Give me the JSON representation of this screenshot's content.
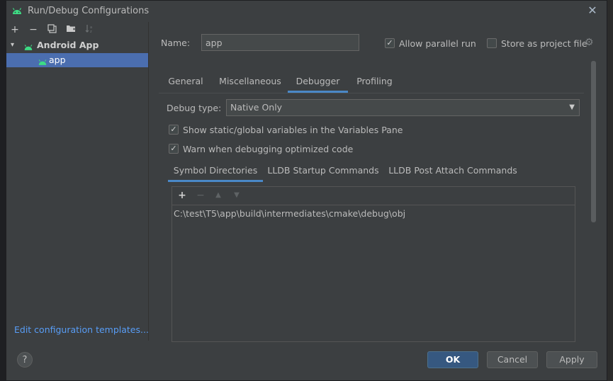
{
  "window": {
    "title": "Run/Debug Configurations",
    "close_icon": "close-icon"
  },
  "left_toolbar": {
    "add": "+",
    "remove": "−",
    "copy": "copy-icon",
    "folder": "folder-icon",
    "sort": "sort-icon"
  },
  "tree": {
    "group_label": "Android App",
    "item_label": "app"
  },
  "left_link": "Edit configuration templates...",
  "name_field": {
    "label": "Name:",
    "value": "app"
  },
  "allow_parallel": {
    "label": "Allow parallel run",
    "checked": true
  },
  "store_project": {
    "label": "Store as project file",
    "checked": false
  },
  "tabs": [
    "General",
    "Miscellaneous",
    "Debugger",
    "Profiling"
  ],
  "active_tab": "Debugger",
  "debug_type": {
    "label": "Debug type:",
    "value": "Native Only"
  },
  "options": [
    {
      "label": "Show static/global variables in the Variables Pane",
      "checked": true
    },
    {
      "label": "Warn when debugging optimized code",
      "checked": true
    }
  ],
  "subtabs": [
    "Symbol Directories",
    "LLDB Startup Commands",
    "LLDB Post Attach Commands"
  ],
  "active_subtab": "Symbol Directories",
  "list_toolbar": {
    "add": "+",
    "remove": "−",
    "up": "▲",
    "down": "▼"
  },
  "symbol_dirs": [
    "C:\\test\\T5\\app\\build\\intermediates\\cmake\\debug\\obj"
  ],
  "buttons": {
    "help": "?",
    "ok": "OK",
    "cancel": "Cancel",
    "apply": "Apply"
  },
  "colors": {
    "accent": "#4a88c7",
    "selection": "#4b6eaf",
    "link": "#589df6",
    "android_green": "#3ddc84"
  }
}
